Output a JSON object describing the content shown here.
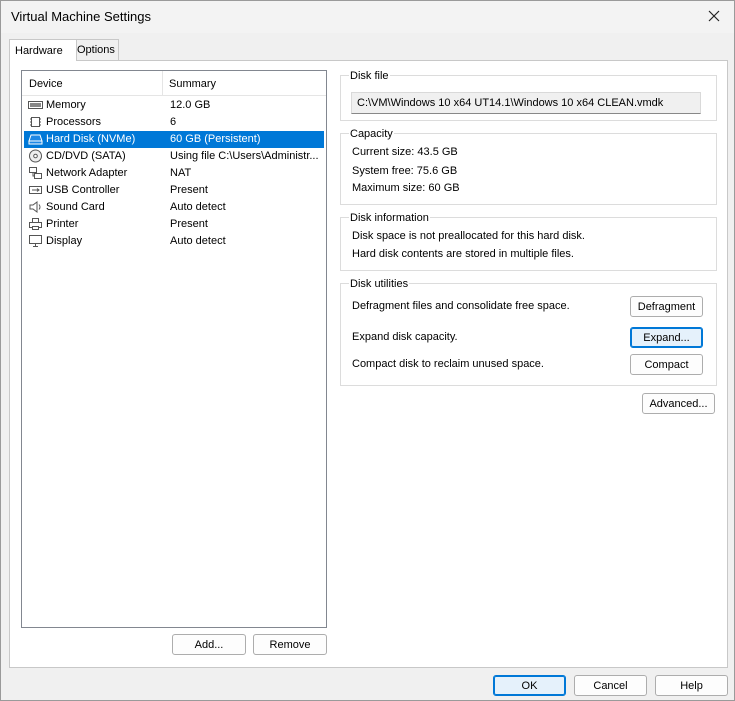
{
  "window": {
    "title": "Virtual Machine Settings"
  },
  "tabs": [
    {
      "label": "Hardware",
      "active": true
    },
    {
      "label": "Options",
      "active": false
    }
  ],
  "device_list": {
    "headers": {
      "device": "Device",
      "summary": "Summary"
    },
    "rows": [
      {
        "icon": "memory-icon",
        "device": "Memory",
        "summary": "12.0 GB",
        "selected": false
      },
      {
        "icon": "processor-icon",
        "device": "Processors",
        "summary": "6",
        "selected": false
      },
      {
        "icon": "hard-disk-icon",
        "device": "Hard Disk (NVMe)",
        "summary": "60 GB (Persistent)",
        "selected": true
      },
      {
        "icon": "cd-dvd-icon",
        "device": "CD/DVD (SATA)",
        "summary": "Using file C:\\Users\\Administr...",
        "selected": false
      },
      {
        "icon": "network-adapter-icon",
        "device": "Network Adapter",
        "summary": "NAT",
        "selected": false
      },
      {
        "icon": "usb-icon",
        "device": "USB Controller",
        "summary": "Present",
        "selected": false
      },
      {
        "icon": "sound-card-icon",
        "device": "Sound Card",
        "summary": "Auto detect",
        "selected": false
      },
      {
        "icon": "printer-icon",
        "device": "Printer",
        "summary": "Present",
        "selected": false
      },
      {
        "icon": "display-icon",
        "device": "Display",
        "summary": "Auto detect",
        "selected": false
      }
    ],
    "add_button": "Add...",
    "remove_button": "Remove"
  },
  "disk_file": {
    "label": "Disk file",
    "path": "C:\\VM\\Windows 10 x64 UT14.1\\Windows 10 x64 CLEAN.vmdk"
  },
  "capacity": {
    "label": "Capacity",
    "current_size": "Current size:  43.5 GB",
    "system_free": "System free:  75.6 GB",
    "maximum_size": "Maximum size:  60 GB"
  },
  "disk_information": {
    "label": "Disk information",
    "line1": "Disk space is not preallocated for this hard disk.",
    "line2": "Hard disk contents are stored in multiple files."
  },
  "disk_utilities": {
    "label": "Disk utilities",
    "defragment_text": "Defragment files and consolidate free space.",
    "defragment_button": "Defragment",
    "expand_text": "Expand disk capacity.",
    "expand_button": "Expand...",
    "compact_text": "Compact disk to reclaim unused space.",
    "compact_button": "Compact"
  },
  "advanced_button": "Advanced...",
  "footer": {
    "ok": "OK",
    "cancel": "Cancel",
    "help": "Help"
  }
}
